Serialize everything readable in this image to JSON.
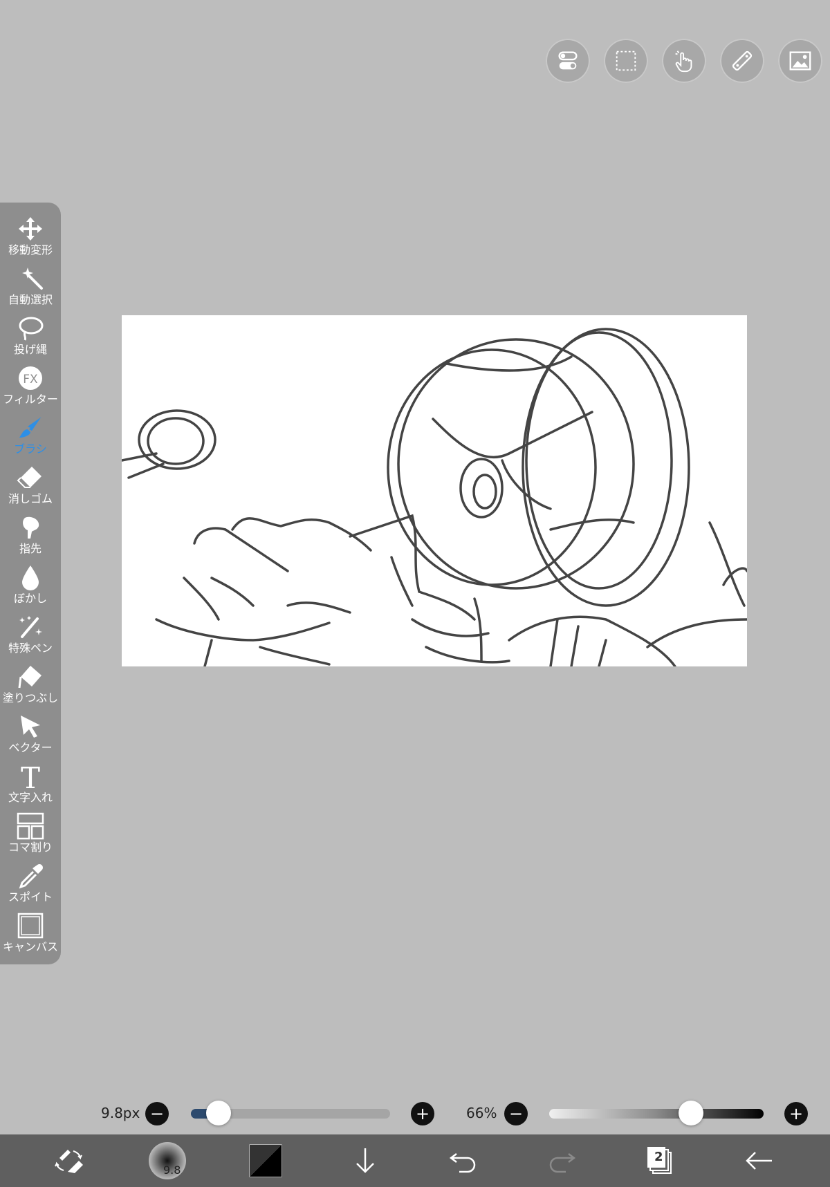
{
  "top_toolbar": {
    "icons": [
      "toggle-icon",
      "selection-icon",
      "hand-icon",
      "ruler-icon",
      "material-icon"
    ]
  },
  "tools": [
    {
      "id": "move",
      "label": "移動変形",
      "icon": "move-icon"
    },
    {
      "id": "magic-wand",
      "label": "自動選択",
      "icon": "magic-wand-icon"
    },
    {
      "id": "lasso",
      "label": "投げ縄",
      "icon": "lasso-icon"
    },
    {
      "id": "filter",
      "label": "フィルター",
      "icon": "fx-icon"
    },
    {
      "id": "brush",
      "label": "ブラシ",
      "icon": "brush-icon",
      "active": true
    },
    {
      "id": "eraser",
      "label": "消しゴム",
      "icon": "eraser-icon"
    },
    {
      "id": "finger",
      "label": "指先",
      "icon": "finger-icon"
    },
    {
      "id": "blur",
      "label": "ぼかし",
      "icon": "blur-icon"
    },
    {
      "id": "special-pen",
      "label": "特殊ペン",
      "icon": "special-pen-icon"
    },
    {
      "id": "fill",
      "label": "塗りつぶし",
      "icon": "fill-icon"
    },
    {
      "id": "vector",
      "label": "ベクター",
      "icon": "vector-icon"
    },
    {
      "id": "text",
      "label": "文字入れ",
      "icon": "text-icon"
    },
    {
      "id": "frame",
      "label": "コマ割り",
      "icon": "frame-divider-icon"
    },
    {
      "id": "eyedropper",
      "label": "スポイト",
      "icon": "eyedropper-icon"
    },
    {
      "id": "canvas",
      "label": "キャンバス",
      "icon": "canvas-icon"
    }
  ],
  "brush_size": {
    "value_label": "9.8px",
    "fraction": 0.14
  },
  "opacity": {
    "value_label": "66%",
    "fraction": 0.66
  },
  "bottom_bar": {
    "brush_preview_label": "9.8",
    "layer_count": "2",
    "icons": [
      "swap-tool-icon",
      "brush-preview-icon",
      "color-swatch-icon",
      "download-icon",
      "undo-icon",
      "redo-icon",
      "layers-icon",
      "back-arrow-icon"
    ]
  },
  "colors": {
    "active": "#2d8fe6",
    "toolbar": "#8e8e8e",
    "bottom_bar": "#5f5f5f",
    "background": "#bdbdbd"
  }
}
